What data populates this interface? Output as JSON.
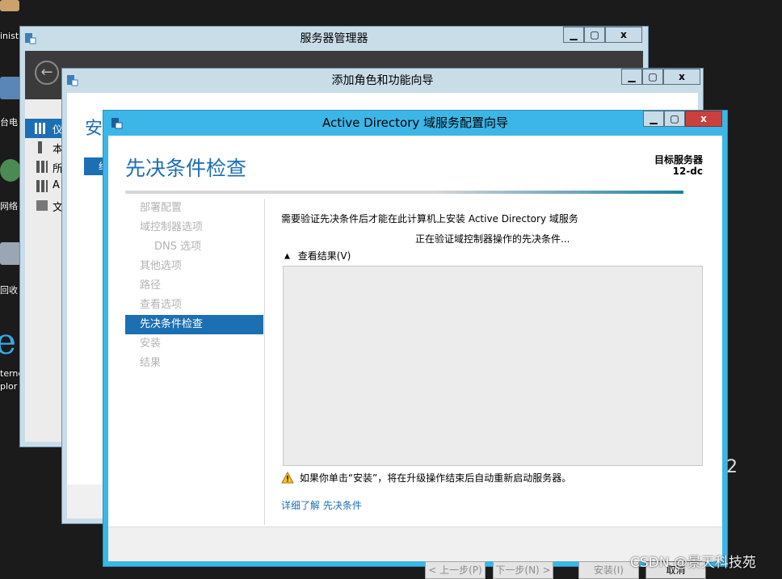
{
  "desktop": {
    "icons": [
      {
        "label": "inist"
      },
      {
        "label": "台电"
      },
      {
        "label": "网络"
      },
      {
        "label": "回收"
      },
      {
        "label": "terne"
      },
      {
        "label": "plor"
      }
    ]
  },
  "server_manager": {
    "title": "服务器管理器",
    "controls": {
      "minimize": "▁",
      "maximize": "▢",
      "close": "x"
    },
    "left_items": [
      {
        "icon": "dashboard-icon",
        "label": "仪"
      },
      {
        "icon": "local-server-icon",
        "label": "本"
      },
      {
        "icon": "all-servers-icon",
        "label": "所"
      },
      {
        "icon": "ad-icon",
        "label": "A"
      },
      {
        "icon": "file-icon",
        "label": "文"
      }
    ]
  },
  "add_roles": {
    "title": "添加角色和功能向导",
    "heading": "安",
    "left_selected": "绍"
  },
  "ad_wizard": {
    "title": "Active Directory 域服务配置向导",
    "page_title": "先决条件检查",
    "target_server_label": "目标服务器",
    "target_server_name": "12-dc",
    "nav": [
      {
        "label": "部署配置",
        "state": "disabled"
      },
      {
        "label": "域控制器选项",
        "state": "disabled"
      },
      {
        "label": "DNS 选项",
        "state": "disabled",
        "sub": true
      },
      {
        "label": "其他选项",
        "state": "disabled"
      },
      {
        "label": "路径",
        "state": "disabled"
      },
      {
        "label": "查看选项",
        "state": "disabled"
      },
      {
        "label": "先决条件检查",
        "state": "active"
      },
      {
        "label": "安装",
        "state": "disabled"
      },
      {
        "label": "结果",
        "state": "disabled"
      }
    ],
    "description": "需要验证先决条件后才能在此计算机上安装 Active Directory 域服务",
    "status": "正在验证域控制器操作的先决条件...",
    "view_results_label": "查看结果(V)",
    "warning_text": "如果你单击“安装”，将在升级操作结束后自动重新启动服务器。",
    "learn_more_link": "详细了解 先决条件",
    "buttons": {
      "prev": "< 上一步(P)",
      "next": "下一步(N) >",
      "install": "安装(I)",
      "cancel": "取消"
    }
  },
  "watermark": "CSDN @景天科技苑",
  "colors": {
    "accent": "#1c6fb3",
    "title_blue": "#1c6fb3",
    "ad_frame": "#3cb6e6",
    "close_red": "#c8413d"
  }
}
